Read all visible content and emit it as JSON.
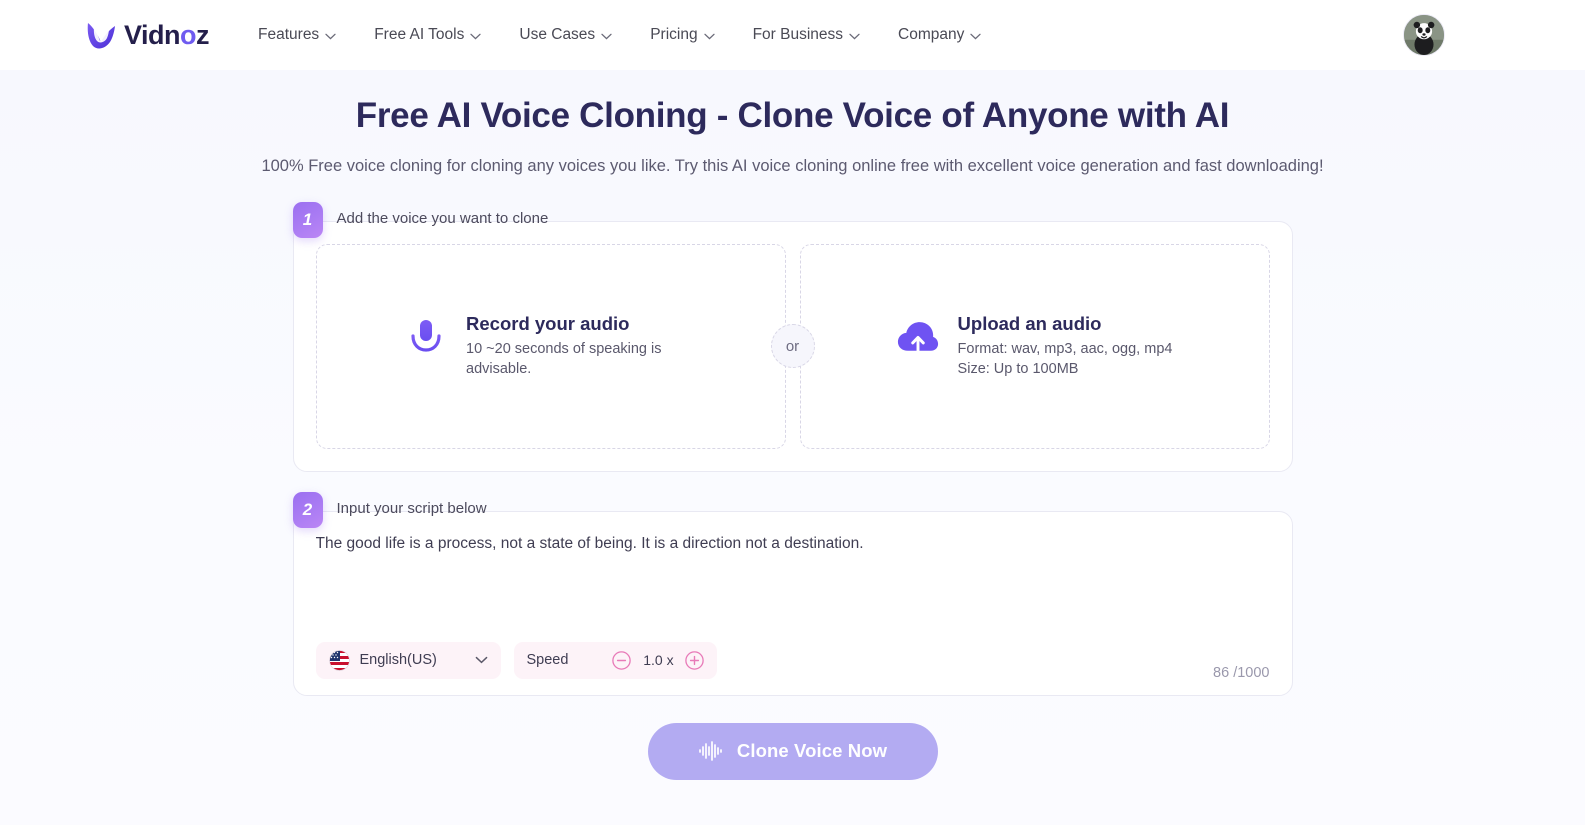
{
  "brand": {
    "name": "Vidnoz",
    "logo_icon": "vidnoz-logo-icon"
  },
  "nav": {
    "items": [
      {
        "label": "Features",
        "icon": "chevron-down-icon"
      },
      {
        "label": "Free AI Tools",
        "icon": "chevron-down-icon"
      },
      {
        "label": "Use Cases",
        "icon": "chevron-down-icon"
      },
      {
        "label": "Pricing",
        "icon": "chevron-down-icon"
      },
      {
        "label": "For Business",
        "icon": "chevron-down-icon"
      },
      {
        "label": "Company",
        "icon": "chevron-down-icon"
      }
    ],
    "avatar_icon": "user-avatar-panda"
  },
  "hero": {
    "title": "Free AI Voice Cloning - Clone Voice of Anyone with AI",
    "subtitle": "100% Free voice cloning for cloning any voices you like. Try this AI voice cloning online free with excellent voice generation and fast downloading!"
  },
  "step1": {
    "number": "1",
    "label": "Add the voice you want to clone",
    "record": {
      "icon": "microphone-icon",
      "title": "Record your audio",
      "desc": "10 ~20 seconds of speaking is advisable."
    },
    "divider_label": "or",
    "upload": {
      "icon": "cloud-upload-icon",
      "title": "Upload an audio",
      "format": "Format: wav, mp3, aac, ogg, mp4",
      "size": "Size: Up to 100MB"
    }
  },
  "step2": {
    "number": "2",
    "label": "Input your script below",
    "script_value": "The good life is a process, not a state of being. It is a direction not a destination.",
    "script_placeholder": "Input your script below",
    "language": {
      "value": "English(US)",
      "flag_icon": "us-flag-icon",
      "chevron_icon": "chevron-down-icon"
    },
    "speed": {
      "label": "Speed",
      "value": "1.0 x",
      "minus_icon": "minus-circle-icon",
      "plus_icon": "plus-circle-icon"
    },
    "char_count": "86 /1000"
  },
  "cta": {
    "label": "Clone Voice Now",
    "icon": "audio-waveform-icon"
  },
  "colors": {
    "brand_purple": "#6f5bf0",
    "accent_violet": "#a97bf3",
    "cta_bg": "#b3abf2",
    "title_navy": "#2d2a5c",
    "control_bg": "#fdf3f8",
    "control_accent": "#e87ab8",
    "page_bg": "#fafaff"
  }
}
